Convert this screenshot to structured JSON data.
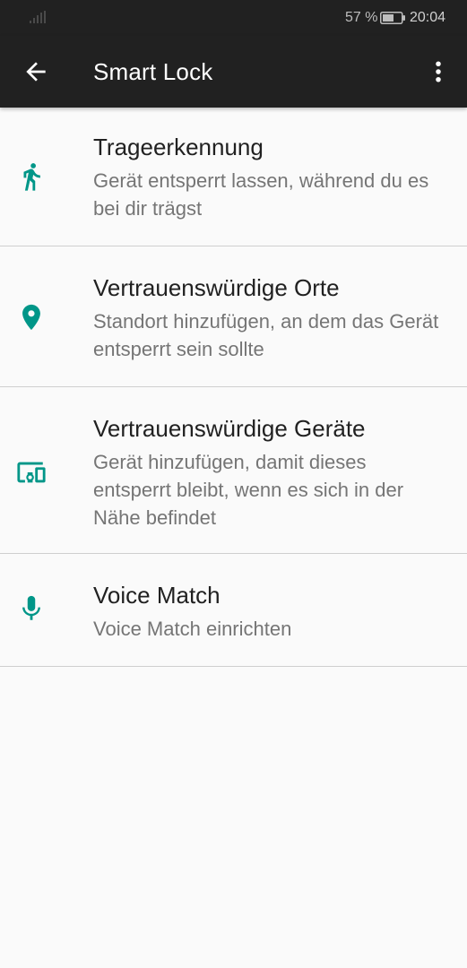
{
  "status_bar": {
    "battery_percent": "57 %",
    "time": "20:04",
    "icons": [
      "signal-icon",
      "battery-icon"
    ]
  },
  "app_bar": {
    "title": "Smart Lock",
    "icons": [
      "back-arrow-icon",
      "more-vert-icon"
    ]
  },
  "items": [
    {
      "title": "Trageerkennung",
      "subtitle": "Gerät entsperrt lassen, während du es bei dir trägst",
      "icon": "walking-person-icon"
    },
    {
      "title": "Vertrauenswürdige Orte",
      "subtitle": "Standort hinzufügen, an dem das Gerät entsperrt sein sollte",
      "icon": "location-pin-icon"
    },
    {
      "title": "Vertrauenswürdige Geräte",
      "subtitle": "Gerät hinzufügen, damit dieses entsperrt bleibt, wenn es sich in der Nähe befindet",
      "icon": "devices-icon"
    },
    {
      "title": "Voice Match",
      "subtitle": "Voice Match einrichten",
      "icon": "microphone-icon"
    }
  ],
  "colors": {
    "accent": "#009688",
    "toolbar": "#212121",
    "background": "#fafafa",
    "divider": "#cfcfcf"
  }
}
